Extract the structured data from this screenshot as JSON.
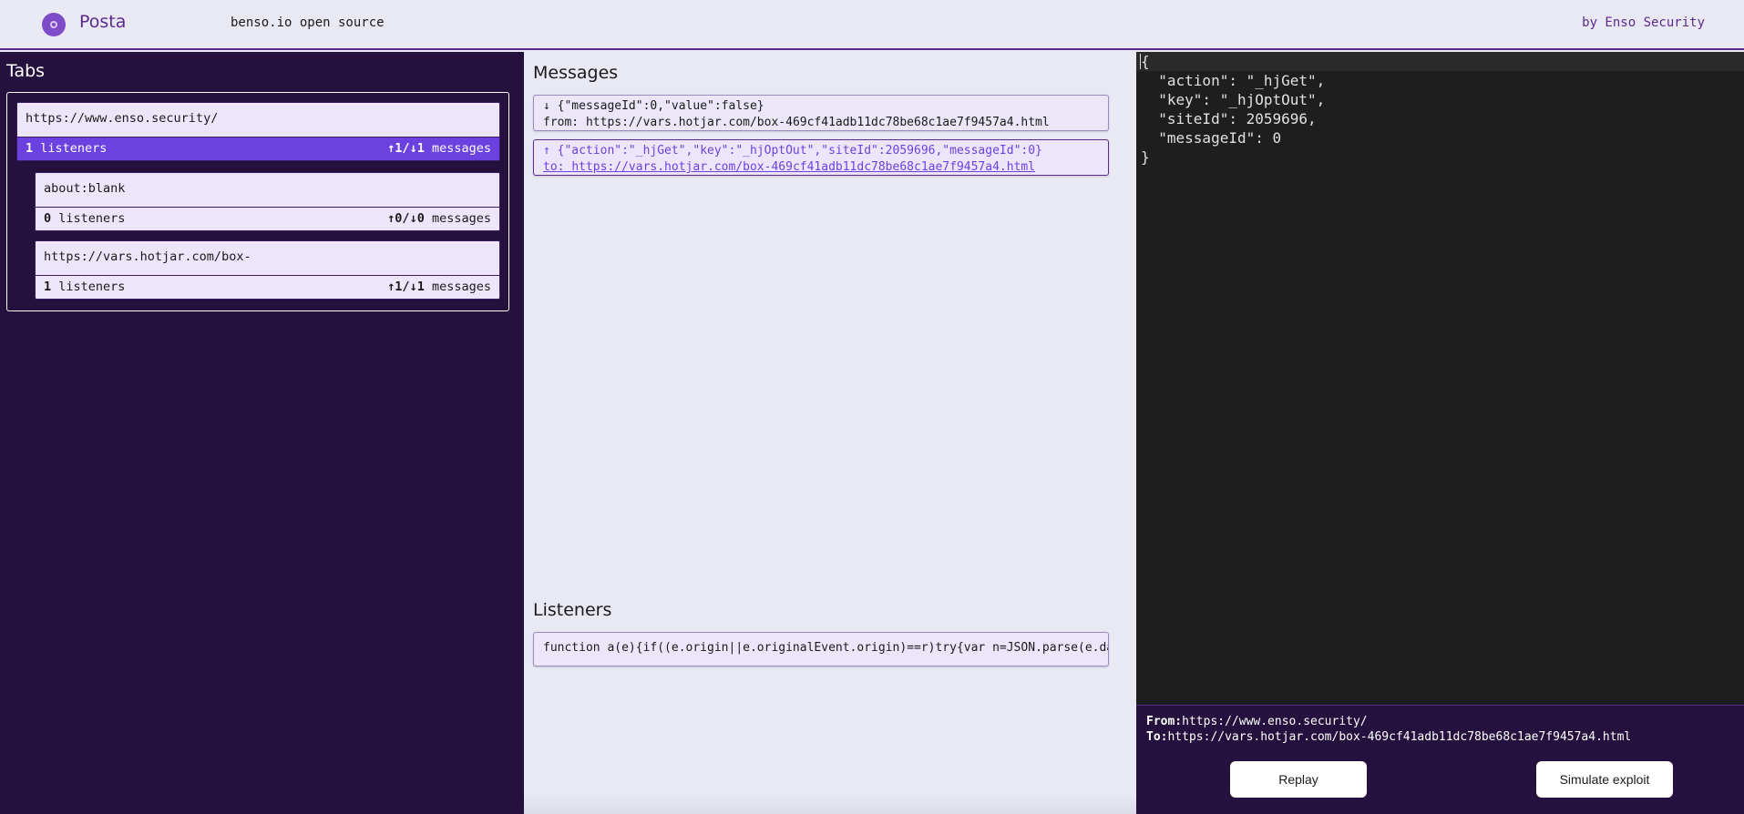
{
  "header": {
    "app_name": "Posta",
    "link": "benso.io open source",
    "credit": "by Enso Security"
  },
  "tabs_panel": {
    "title": "Tabs",
    "tabs": [
      {
        "url": "https://www.enso.security/",
        "listeners_count": "1",
        "listeners_label": "listeners",
        "sent": "1",
        "received": "1",
        "messages_label": "messages",
        "selected": true
      },
      {
        "url": "about:blank",
        "listeners_count": "0",
        "listeners_label": "listeners",
        "sent": "0",
        "received": "0",
        "messages_label": "messages",
        "selected": false
      },
      {
        "url": "https://vars.hotjar.com/box-",
        "listeners_count": "1",
        "listeners_label": "listeners",
        "sent": "1",
        "received": "1",
        "messages_label": "messages",
        "selected": false
      }
    ]
  },
  "messages_panel": {
    "title": "Messages",
    "messages": [
      {
        "direction_icon": "↓",
        "body": "{\"messageId\":0,\"value\":false}",
        "peer_label": "from:",
        "peer": "https://vars.hotjar.com/box-469cf41adb11dc78be68c1ae7f9457a4.html"
      },
      {
        "direction_icon": "↑",
        "body": "{\"action\":\"_hjGet\",\"key\":\"_hjOptOut\",\"siteId\":2059696,\"messageId\":0}",
        "peer_label": "to:",
        "peer": "https://vars.hotjar.com/box-469cf41adb11dc78be68c1ae7f9457a4.html"
      }
    ]
  },
  "listeners_panel": {
    "title": "Listeners",
    "items": [
      "function a(e){if((e.origin||e.originalEvent.origin)==r)try{var n=JSON.parse(e.data"
    ]
  },
  "editor": {
    "lines": [
      "{",
      "  \"action\": \"_hjGet\",",
      "  \"key\": \"_hjOptOut\",",
      "  \"siteId\": 2059696,",
      "  \"messageId\": 0",
      "}"
    ]
  },
  "details": {
    "from_label": "From:",
    "from": "https://www.enso.security/",
    "to_label": "To:",
    "to": "https://vars.hotjar.com/box-469cf41adb11dc78be68c1ae7f9457a4.html",
    "replay_label": "Replay",
    "simulate_label": "Simulate exploit"
  }
}
